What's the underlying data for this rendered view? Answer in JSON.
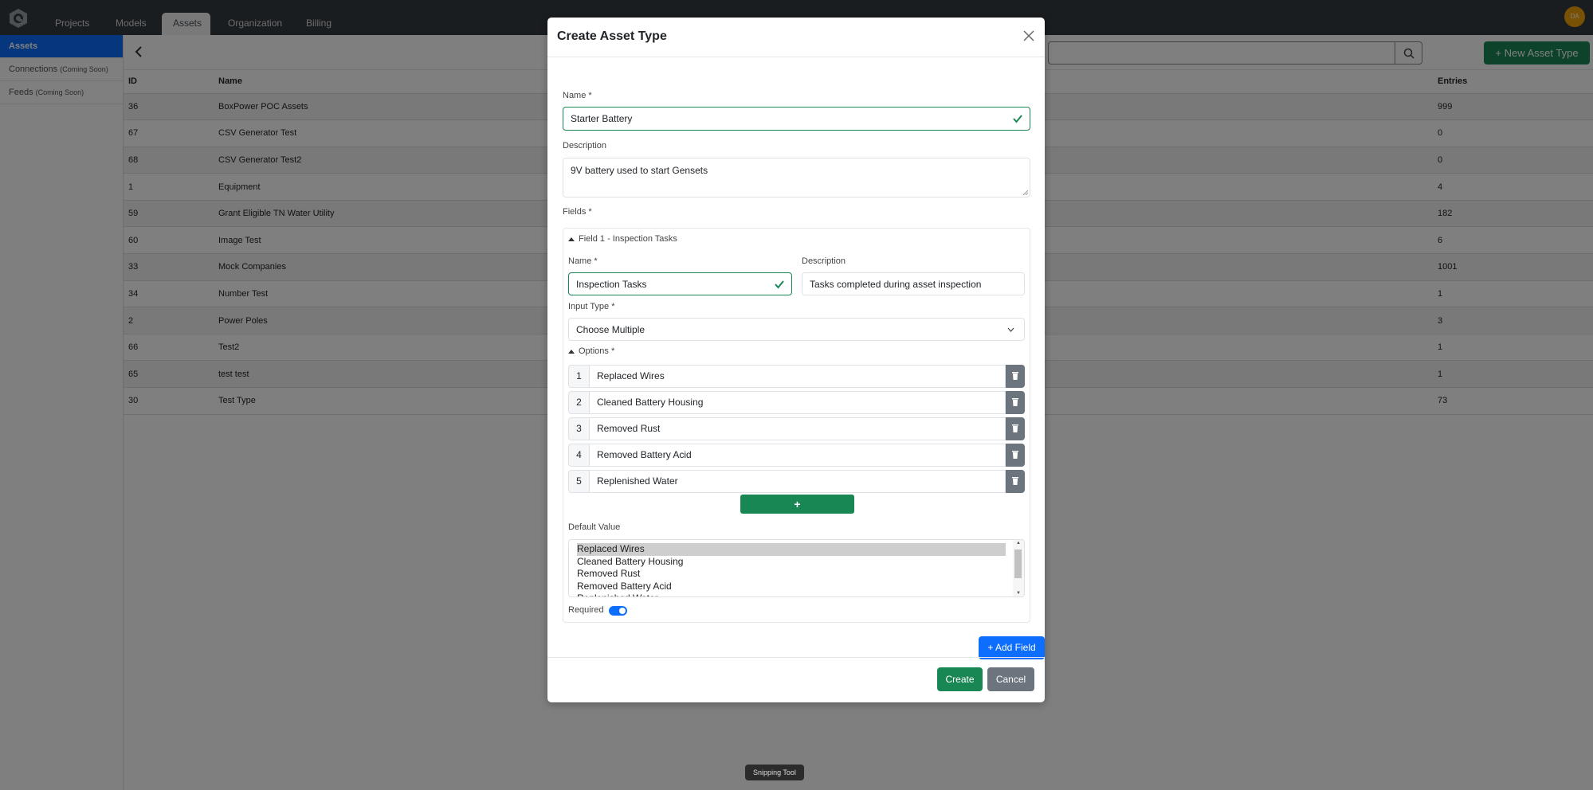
{
  "navbar": {
    "tabs": [
      {
        "label": "Projects",
        "active": false
      },
      {
        "label": "Models",
        "active": false
      },
      {
        "label": "Assets",
        "active": true
      },
      {
        "label": "Organization",
        "active": false
      },
      {
        "label": "Billing",
        "active": false
      }
    ],
    "avatar_initials": "DA",
    "avatar_color": "#f0a30a"
  },
  "sidebar": {
    "items": [
      {
        "label": "Assets",
        "suffix": "",
        "active": true
      },
      {
        "label": "Connections",
        "suffix": "(Coming Soon)",
        "active": false
      },
      {
        "label": "Feeds",
        "suffix": "(Coming Soon)",
        "active": false
      }
    ]
  },
  "toolbar": {
    "search_placeholder": "",
    "new_button_label": "+ New Asset Type"
  },
  "table": {
    "columns": [
      "ID",
      "Name",
      "Entries"
    ],
    "rows": [
      {
        "id": "36",
        "name": "BoxPower POC Assets",
        "entries": "999"
      },
      {
        "id": "67",
        "name": "CSV Generator Test",
        "entries": "0"
      },
      {
        "id": "68",
        "name": "CSV Generator Test2",
        "entries": "0"
      },
      {
        "id": "1",
        "name": "Equipment",
        "entries": "4"
      },
      {
        "id": "59",
        "name": "Grant Eligible TN Water Utility",
        "entries": "182"
      },
      {
        "id": "60",
        "name": "Image Test",
        "entries": "6"
      },
      {
        "id": "33",
        "name": "Mock Companies",
        "entries": "1001"
      },
      {
        "id": "34",
        "name": "Number Test",
        "entries": "1"
      },
      {
        "id": "2",
        "name": "Power Poles",
        "entries": "3"
      },
      {
        "id": "66",
        "name": "Test2",
        "entries": "1"
      },
      {
        "id": "65",
        "name": "test test",
        "entries": "1"
      },
      {
        "id": "30",
        "name": "Test Type",
        "entries": "73"
      }
    ]
  },
  "modal": {
    "title": "Create Asset Type",
    "name_label": "Name *",
    "name_value": "Starter Battery",
    "description_label": "Description",
    "description_value": "9V battery used to start Gensets",
    "fields_label": "Fields *",
    "field": {
      "header": "Field 1 - Inspection Tasks",
      "name_label": "Name *",
      "name_value": "Inspection Tasks",
      "description_label": "Description",
      "description_value": "Tasks completed during asset inspection",
      "input_type_label": "Input Type *",
      "input_type_value": "Choose Multiple",
      "options_label": "Options *",
      "options": [
        {
          "num": "1",
          "value": "Replaced Wires"
        },
        {
          "num": "2",
          "value": "Cleaned Battery Housing"
        },
        {
          "num": "3",
          "value": "Removed Rust"
        },
        {
          "num": "4",
          "value": "Removed Battery Acid"
        },
        {
          "num": "5",
          "value": "Replenished Water"
        }
      ],
      "add_option_label": "+",
      "default_value_label": "Default Value",
      "default_list": [
        "Replaced Wires",
        "Cleaned Battery Housing",
        "Removed Rust",
        "Removed Battery Acid",
        "Replenished Water"
      ],
      "default_selected": "Replaced Wires",
      "required_label": "Required",
      "required_on": true
    },
    "add_field_label": "+ Add Field",
    "create_label": "Create",
    "cancel_label": "Cancel"
  },
  "tooltip": "Snipping Tool",
  "colors": {
    "primary": "#0d6efd",
    "success": "#198754",
    "secondary": "#6c757d",
    "navbar": "#343a40"
  }
}
